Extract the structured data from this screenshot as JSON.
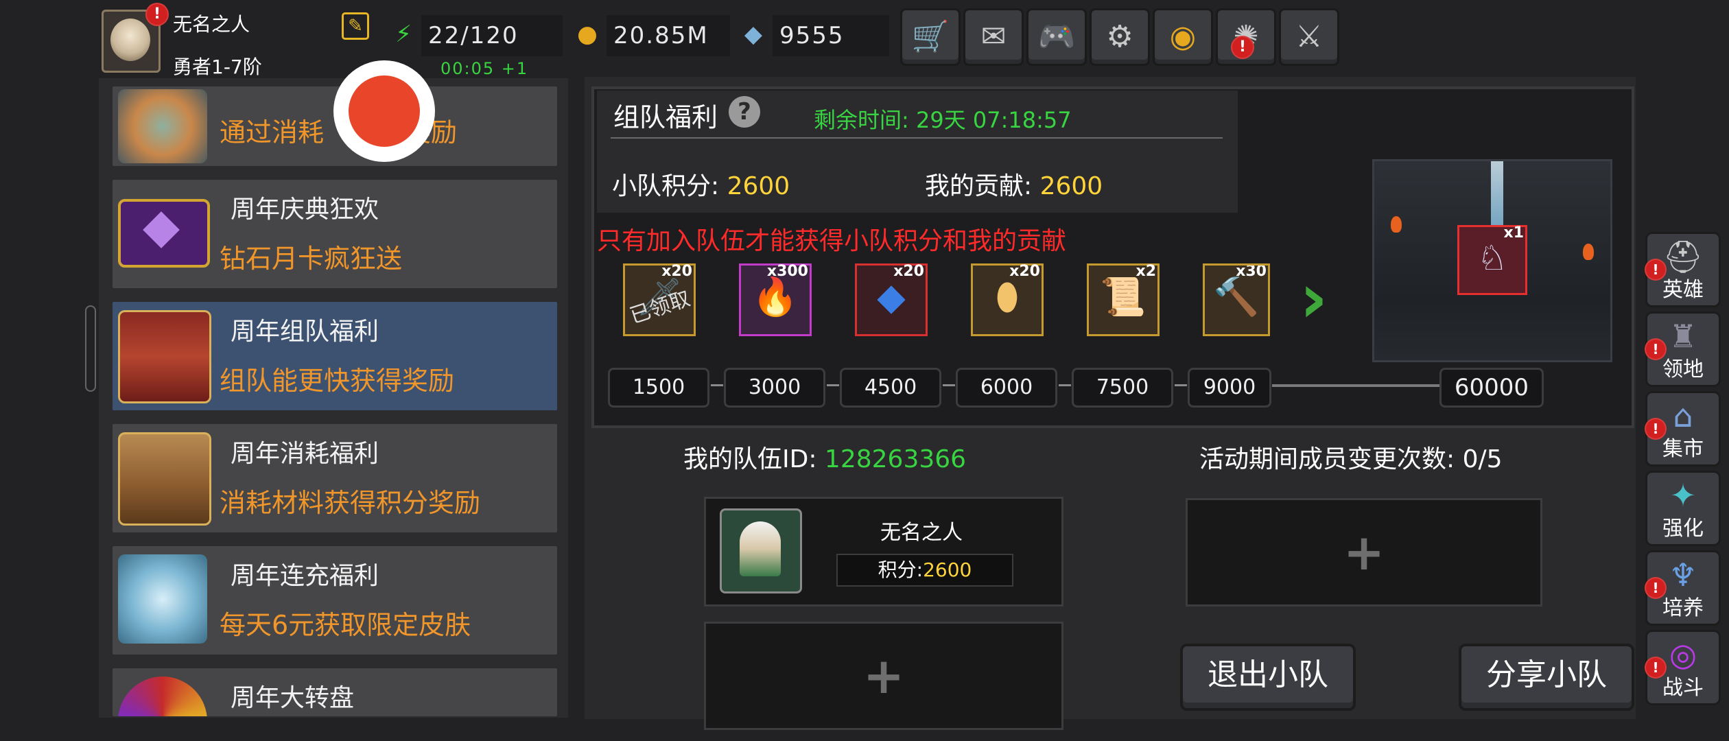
{
  "player": {
    "name": "无名之人",
    "rank": "勇者1-7阶"
  },
  "resources": {
    "stamina": "22/120",
    "stamina_timer": "00:05 +1",
    "gold": "20.85M",
    "diamond": "9555"
  },
  "top_buttons": [
    "shop-cart-icon",
    "mail-icon",
    "gamepad-icon",
    "settings-gear-icon",
    "color-wheel-icon",
    "firework-icon",
    "crossed-swords-icon"
  ],
  "event_list": [
    {
      "title": "",
      "subtitle": "通过消耗",
      "subtitle_tail": "奖励"
    },
    {
      "title": "周年庆典狂欢",
      "subtitle": "钻石月卡疯狂送"
    },
    {
      "title": "周年组队福利",
      "subtitle": "组队能更快获得奖励",
      "selected": true
    },
    {
      "title": "周年消耗福利",
      "subtitle": "消耗材料获得积分奖励"
    },
    {
      "title": "周年连充福利",
      "subtitle": "每天6元获取限定皮肤"
    },
    {
      "title": "周年大转盘",
      "subtitle": ""
    }
  ],
  "panel": {
    "title": "组队福利",
    "help": "?",
    "remaining_label": "剩余时间:",
    "remaining_value": "29天 07:18:57",
    "team_score_label": "小队积分:",
    "team_score_value": "2600",
    "my_contrib_label": "我的贡献:",
    "my_contrib_value": "2600",
    "notice": "只有加入队伍才能获得小队积分和我的贡献"
  },
  "rewards": [
    {
      "qty": "x20",
      "icon": "sword-icon",
      "claimed_label": "已领取",
      "milestone": "1500"
    },
    {
      "qty": "x300",
      "icon": "fire-gem-icon",
      "milestone": "3000"
    },
    {
      "qty": "x20",
      "icon": "blue-crystal-icon",
      "milestone": "4500"
    },
    {
      "qty": "x20",
      "icon": "egg-icon",
      "milestone": "6000"
    },
    {
      "qty": "x2",
      "icon": "scroll-icon",
      "milestone": "7500"
    },
    {
      "qty": "x30",
      "icon": "hammer-icon",
      "milestone": "9000"
    }
  ],
  "grand_reward": {
    "qty": "x1",
    "milestone": "60000"
  },
  "team": {
    "id_label": "我的队伍ID:",
    "id_value": "128263366",
    "change_label": "活动期间成员变更次数:",
    "change_value": "0/5",
    "member_name": "无名之人",
    "member_score_label": "积分:",
    "member_score_value": "2600",
    "leave_button": "退出小队",
    "share_button": "分享小队"
  },
  "side_nav": [
    {
      "label": "英雄",
      "icon": "helmet-icon"
    },
    {
      "label": "领地",
      "icon": "castle-icon"
    },
    {
      "label": "集市",
      "icon": "market-icon"
    },
    {
      "label": "强化",
      "icon": "crystal-icon"
    },
    {
      "label": "培养",
      "icon": "chalice-icon"
    },
    {
      "label": "战斗",
      "icon": "portal-icon"
    }
  ],
  "colors": {
    "accent_orange": "#f0962a",
    "green": "#39d441",
    "yellow": "#ffd43b",
    "warning_red": "#ff2a2a"
  }
}
